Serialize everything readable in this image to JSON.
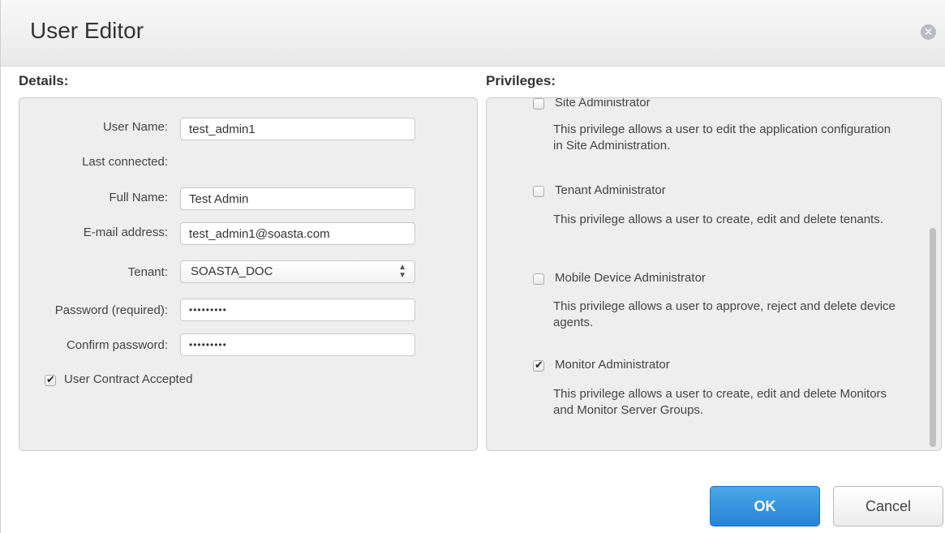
{
  "dialog": {
    "title": "User Editor",
    "close_icon": "close-icon"
  },
  "details": {
    "heading": "Details:",
    "user_name_label": "User Name:",
    "user_name_value": "test_admin1",
    "last_connected_label": "Last connected:",
    "full_name_label": "Full Name:",
    "full_name_value": "Test Admin",
    "email_label": "E-mail address:",
    "email_value": "test_admin1@soasta.com",
    "tenant_label": "Tenant:",
    "tenant_value": "SOASTA_DOC",
    "password_label": "Password (required):",
    "password_value": "•••••••••",
    "confirm_label": "Confirm password:",
    "confirm_value": "•••••••••",
    "contract_label": "User Contract Accepted",
    "contract_checked": true
  },
  "privileges": {
    "heading": "Privileges:",
    "items": [
      {
        "label": "Site Administrator",
        "description": "This privilege allows a user to edit the application configuration in Site Administration.",
        "checked": false
      },
      {
        "label": "Tenant Administrator",
        "description": "This privilege allows a user to create, edit and delete tenants.",
        "checked": false
      },
      {
        "label": "Mobile Device Administrator",
        "description": "This privilege allows a user to approve, reject and delete device agents.",
        "checked": false
      },
      {
        "label": "Monitor Administrator",
        "description": "This privilege allows a user to create, edit and delete Monitors and Monitor Server Groups.",
        "checked": true
      }
    ]
  },
  "footer": {
    "ok_label": "OK",
    "cancel_label": "Cancel"
  },
  "colors": {
    "primary_button": "#2583d6",
    "panel_background": "#eeeeee"
  }
}
